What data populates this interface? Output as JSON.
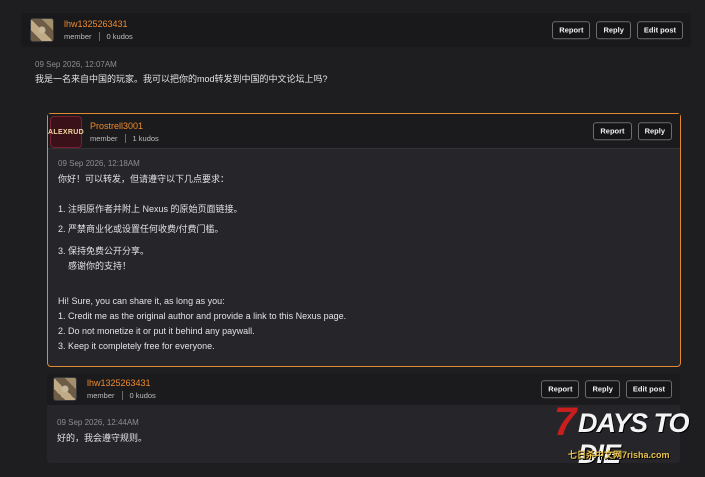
{
  "post1": {
    "username": "lhw1325263431",
    "role": "member",
    "kudos": "0 kudos",
    "buttons": {
      "report": "Report",
      "reply": "Reply",
      "edit": "Edit post"
    },
    "time": "09 Sep 2026, 12:07AM",
    "text": "我是一名来自中国的玩家。我可以把你的mod转发到中国的中文论坛上吗?"
  },
  "post2": {
    "avatar_text": "ALEXRUD",
    "username": "Prostrell3001",
    "role": "member",
    "kudos": "1 kudos",
    "buttons": {
      "report": "Report",
      "reply": "Reply"
    },
    "time": "09 Sep 2026, 12:18AM",
    "lines": [
      "你好！可以转发，但请遵守以下几点要求：",
      "1. 注明原作者并附上 Nexus 的原始页面链接。",
      "2. 严禁商业化或设置任何收费/付费门槛。",
      "3. 保持免费公开分享。",
      "感谢你的支持！",
      "Hi! Sure, you can share it, as long as you:",
      "1. Credit me as the original author and provide a link to this Nexus page.",
      "2. Do not monetize it or put it behind any paywall.",
      "3. Keep it completely free for everyone."
    ]
  },
  "post3": {
    "username": "lhw1325263431",
    "role": "member",
    "kudos": "0 kudos",
    "buttons": {
      "report": "Report",
      "reply": "Reply",
      "edit": "Edit post"
    },
    "time": "09 Sep 2026, 12:44AM",
    "text": "好的，我会遵守规则。"
  },
  "watermark": {
    "seven": "7",
    "title": "DAYS TO DIE",
    "subtitle": "七日杀中文网7risha.com"
  },
  "colors": {
    "accent": "#f08a2c",
    "border_highlight": "#e08a32"
  }
}
